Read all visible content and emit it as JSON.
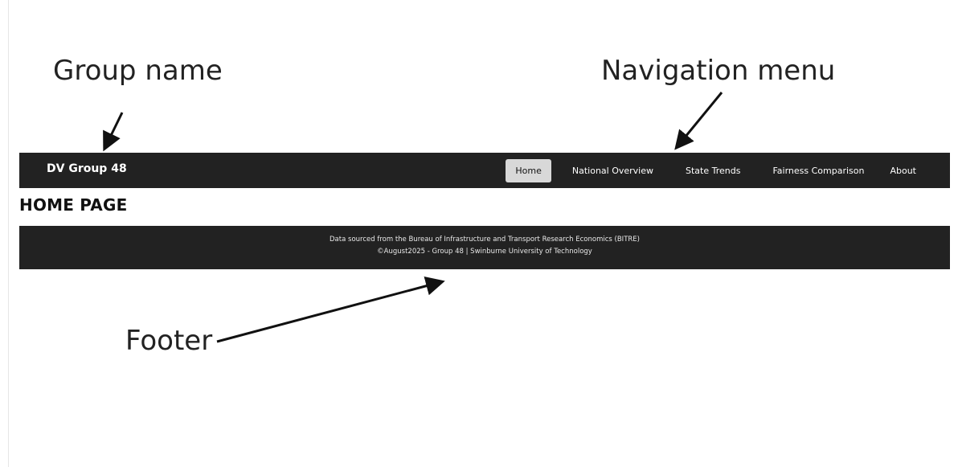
{
  "annotations": {
    "group_name": "Group name",
    "navigation_menu": "Navigation menu",
    "footer": "Footer"
  },
  "navbar": {
    "brand": "DV Group 48",
    "items": [
      {
        "label": "Home",
        "active": true
      },
      {
        "label": "National Overview",
        "active": false
      },
      {
        "label": "State Trends",
        "active": false
      },
      {
        "label": "Fairness Comparison",
        "active": false
      },
      {
        "label": "About",
        "active": false
      }
    ]
  },
  "main": {
    "title": "HOME PAGE"
  },
  "footer": {
    "line1": "Data sourced from the Bureau of Infrastructure and Transport Research Economics (BITRE)",
    "line2": "©August2025 - Group 48 | Swinburne University of Technology"
  },
  "colors": {
    "bar_background": "#222222",
    "active_tab": "#d8d8d8",
    "text_light": "#ffffff"
  }
}
